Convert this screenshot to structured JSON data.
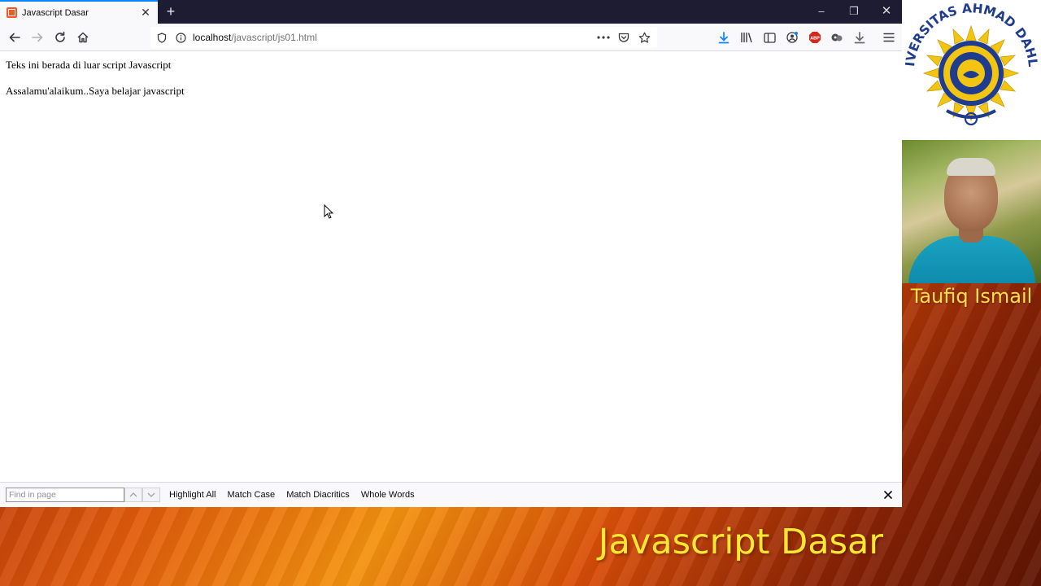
{
  "browser": {
    "tab": {
      "title": "Javascript Dasar",
      "favicon": "xampp-favicon-icon"
    },
    "new_tab_label": "+",
    "window_controls": {
      "minimize": "–",
      "restore": "❐",
      "close": "✕"
    },
    "url": {
      "host": "localhost",
      "path": "/javascript/js01.html"
    },
    "colors": {
      "accent": "#0a84ff",
      "titlebar": "#1d1c33",
      "toolbar": "#f9f9fb"
    }
  },
  "page": {
    "line1": "Teks ini berada di luar script Javascript",
    "line2": "Assalamu'alaikum..Saya belajar javascript"
  },
  "findbar": {
    "placeholder": "Find in page",
    "highlight_all": "Highlight All",
    "match_case": "Match Case",
    "match_diacritics": "Match Diacritics",
    "whole_words": "Whole Words"
  },
  "overlay": {
    "logo_text": "UNIVERSITAS AHMAD DAHLAN",
    "presenter_name": "Taufiq Ismail",
    "course_title": "Javascript Dasar",
    "colors": {
      "title_yellow": "#ffe733",
      "name_yellow": "#ffe14a",
      "orange": "#e35d0c"
    }
  }
}
